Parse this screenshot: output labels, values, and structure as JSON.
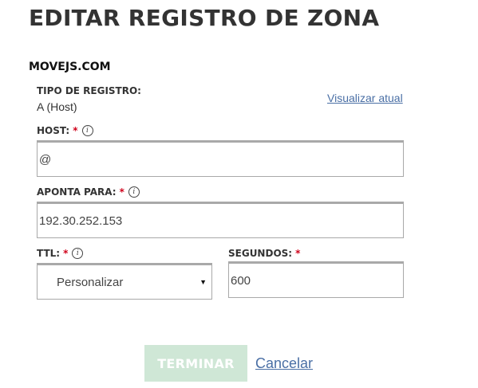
{
  "page": {
    "title": "EDITAR REGISTRO DE ZONA",
    "domain": "MOVEJS.COM"
  },
  "record_type": {
    "label": "TIPO DE REGISTRO:",
    "value": "A (Host)",
    "view_current_link": "Visualizar atual"
  },
  "host": {
    "label": "HOST:",
    "required_mark": "*",
    "info_icon": "i",
    "value": "@"
  },
  "points_to": {
    "label": "APONTA PARA:",
    "required_mark": "*",
    "info_icon": "i",
    "value": "192.30.252.153"
  },
  "ttl": {
    "label": "TTL:",
    "required_mark": "*",
    "info_icon": "i",
    "selected": "Personalizar",
    "caret": "▼"
  },
  "seconds": {
    "label": "SEGUNDOS:",
    "required_mark": "*",
    "value": "600"
  },
  "actions": {
    "finish_label": "TERMINAR",
    "cancel_label": "Cancelar"
  },
  "colors": {
    "finish_button_bg": "#cfe7d6",
    "link": "#4a6fa5",
    "required": "#d0021b"
  }
}
